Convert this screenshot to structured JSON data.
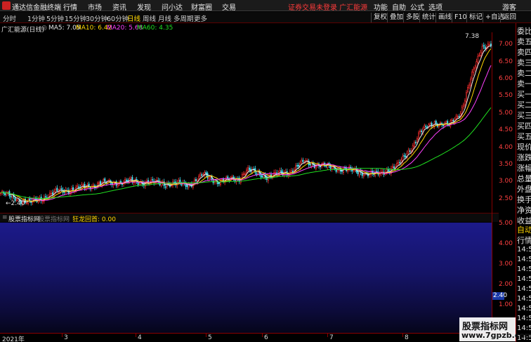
{
  "app": {
    "name": "通达信金融终端",
    "login_status": "证券交易未登录  广汇能源"
  },
  "menu": [
    "行情",
    "市场",
    "资讯",
    "发现",
    "问小达",
    "财富圈",
    "交易"
  ],
  "right_menu": [
    "功能",
    "自助",
    "公式",
    "选项",
    "游客"
  ],
  "periods": [
    "分时",
    "1分钟",
    "5分钟",
    "15分钟",
    "30分钟",
    "60分钟",
    "日线",
    "周线",
    "月线",
    "多周期",
    "更多"
  ],
  "active_period": "日线",
  "tools": [
    "复权",
    "叠加",
    "多股",
    "统计",
    "画线",
    "F10",
    "标记",
    "+自选",
    "返回"
  ],
  "chart": {
    "title": "广汇能源(日线)",
    "ma": [
      {
        "label": "MA5: 7.05",
        "color": "#e8e8e8"
      },
      {
        "label": "MA10: 6.42",
        "color": "#ffd700"
      },
      {
        "label": "MA20: 5.68",
        "color": "#ff40ff"
      },
      {
        "label": "MA60: 4.35",
        "color": "#20e020"
      }
    ],
    "high_label": "7.38",
    "low_label": "2.40",
    "yticks": [
      "7.00",
      "6.50",
      "6.00",
      "5.50",
      "5.00",
      "4.50",
      "4.00",
      "3.50",
      "3.00",
      "2.50"
    ],
    "colors": {
      "up": "#ff3030",
      "down": "#40e0f0",
      "ma5": "#e8e8e8",
      "ma10": "#ffd700",
      "ma20": "#ff40ff",
      "ma60": "#20e020"
    }
  },
  "chart_data": {
    "type": "candlestick",
    "ylim": [
      2.3,
      7.5
    ],
    "x": [],
    "closes": [],
    "ma60": [],
    "x_labels": [
      "2021年",
      "3",
      "4",
      "5",
      "6",
      "7",
      "8"
    ]
  },
  "sub": {
    "tabs": [
      "股票指标网",
      "股票指标网"
    ],
    "indicator": "狂龙回首: 0.00",
    "yticks": [
      "5.00",
      "4.00",
      "3.00",
      "2.00",
      "1.00"
    ],
    "current_value": "2.40"
  },
  "side": {
    "labels": [
      "委比",
      "卖五",
      "卖四",
      "卖三",
      "卖二",
      "卖一",
      "买一",
      "买二",
      "买三",
      "买四",
      "买五",
      "现价",
      "涨跌",
      "涨幅",
      "总量",
      "外盘",
      "换手",
      "净资",
      "收益",
      "自动",
      "行情"
    ],
    "times": [
      "14:5",
      "14:5",
      "14:5",
      "14:5",
      "14:5",
      "14:5",
      "14:5",
      "14:5",
      "14:5",
      "14:5"
    ]
  },
  "watermark": {
    "line1": "股票指标网",
    "line2": "www.7gpzb.com"
  }
}
